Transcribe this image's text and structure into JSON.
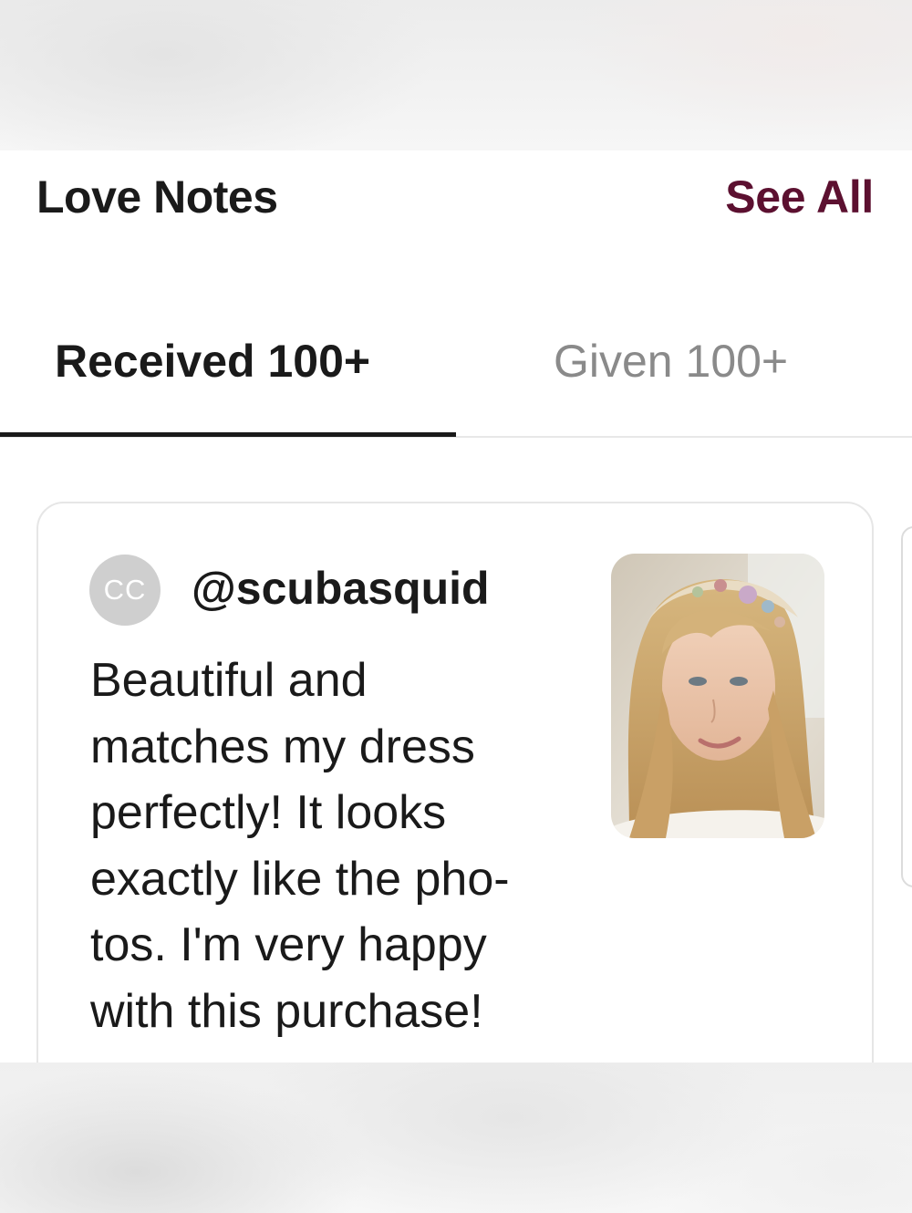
{
  "header": {
    "title": "Love Notes",
    "see_all_label": "See All"
  },
  "tabs": [
    {
      "label": "Received 100+",
      "active": true
    },
    {
      "label": "Given 100+",
      "active": false
    }
  ],
  "review": {
    "avatar_initials": "CC",
    "username": "@scubasquid",
    "text_lines": [
      "Beautiful and",
      "matches my dress",
      "perfectly! It looks",
      "exactly like the pho-",
      "tos. I'm very happy",
      "with this purchase!"
    ],
    "photo_icon": "product-photo-headband"
  },
  "colors": {
    "accent": "#5c1030",
    "text_primary": "#1a1a1a",
    "text_muted": "#8a8a8a",
    "avatar_bg": "#cfcfcf"
  }
}
